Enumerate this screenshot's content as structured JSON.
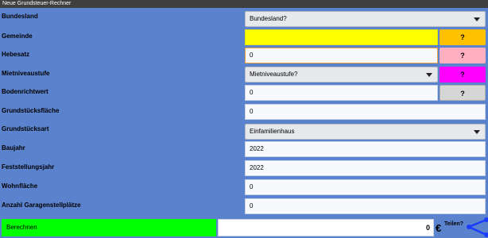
{
  "window": {
    "title": "Neue Grundsteuer-Rechner"
  },
  "colors": {
    "background": "#5b82cd",
    "gemeinde_field": "#ffff00",
    "gemeinde_button": "#ffc000",
    "hebesatz_button": "#ffb0c0",
    "mietniveau_button": "#ff00ff",
    "boden_button": "#d6d6d6",
    "calc_button": "#00ff00"
  },
  "form": {
    "bundesland": {
      "label": "Bundesland",
      "value": "Bundesland?"
    },
    "gemeinde": {
      "label": "Gemeinde",
      "value": "",
      "help": "?"
    },
    "hebesatz": {
      "label": "Hebesatz",
      "value": "0",
      "help": "?"
    },
    "mietniveau": {
      "label": "Mietniveaustufe",
      "value": "Mietniveaustufe?",
      "help": "?"
    },
    "bodenrichtwert": {
      "label": "Bodenrichtwert",
      "value": "0",
      "help": "?"
    },
    "grundstuecksflaeche": {
      "label": "Grundstücksfläche",
      "value": "0"
    },
    "grundstuecksart": {
      "label": "Grundstücksart",
      "value": "Einfamilienhaus"
    },
    "baujahr": {
      "label": "Baujahr",
      "value": "2022"
    },
    "feststellungsjahr": {
      "label": "Feststellungsjahr",
      "value": "2022"
    },
    "wohnflaeche": {
      "label": "Wohnfläche",
      "value": "0"
    },
    "garagen": {
      "label": "Anzahl Garagenstellplätze",
      "value": "0"
    }
  },
  "footer": {
    "calc_label": "Berechnen",
    "result": "0",
    "currency": "€",
    "share_label": "Teilen?",
    "share_icon": "share-icon"
  }
}
